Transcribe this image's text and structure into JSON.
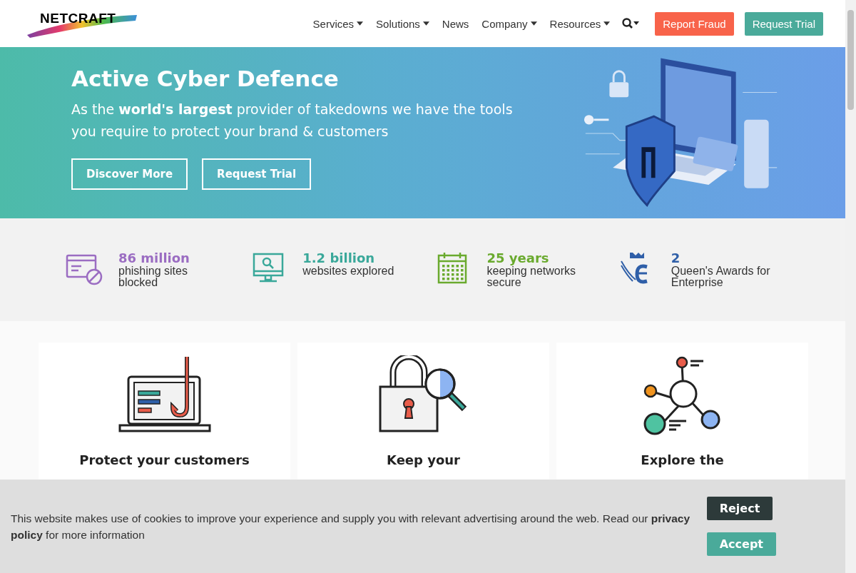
{
  "header": {
    "logo": "NETCRAFT",
    "nav": [
      {
        "label": "Services",
        "dropdown": true
      },
      {
        "label": "Solutions",
        "dropdown": true
      },
      {
        "label": "News",
        "dropdown": false
      },
      {
        "label": "Company",
        "dropdown": true
      },
      {
        "label": "Resources",
        "dropdown": true
      }
    ],
    "buttons": [
      {
        "label": "Report Fraud",
        "kind": "danger"
      },
      {
        "label": "Request Trial",
        "kind": "primary"
      }
    ]
  },
  "hero": {
    "title": "Active Cyber Defence",
    "subtitle": "As the **world's largest** provider of takedowns we have the tools you require to protect your brand & customers",
    "buttons": [
      "Discover More",
      "Request Trial"
    ]
  },
  "stats": [
    {
      "value": "86 million",
      "label": "phishing sites blocked",
      "kind": "blocked",
      "color": "#9b6dc2"
    },
    {
      "value": "1.2 billion",
      "label": "websites explored",
      "kind": "monitor",
      "color": "#3aa89a"
    },
    {
      "value": "25 years",
      "label": "keeping networks secure",
      "kind": "calendar",
      "color": "#6aaa2e"
    },
    {
      "value": "2",
      "label": "Queen's Awards for Enterprise",
      "kind": "award",
      "color": "#2f5fa8"
    }
  ],
  "cards": [
    {
      "title": "Protect your customers",
      "kind": "hook"
    },
    {
      "title": "Keep your",
      "kind": "lock"
    },
    {
      "title": "Explore the",
      "kind": "network"
    }
  ],
  "cookie_banner": {
    "text": "This website makes use of cookies to improve your experience and supply you with relevant advertising around the web. Read our **privacy policy** for more information",
    "buttons": [
      {
        "label": "Reject",
        "kind": "dark"
      },
      {
        "label": "Accept",
        "kind": "primary"
      }
    ]
  }
}
